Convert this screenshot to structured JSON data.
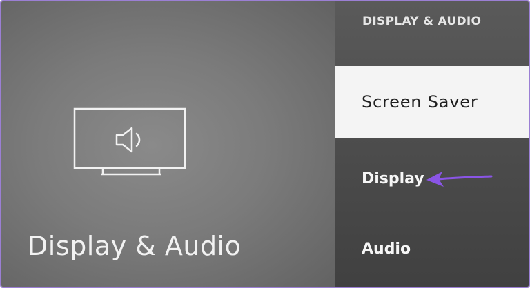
{
  "colors": {
    "accent_border": "#9b7fd4",
    "arrow": "#8a55e6",
    "selected_bg": "#f4f4f4",
    "left_pane_bg": "#7b7b7b",
    "right_pane_bg": "#4b4b4b"
  },
  "left_pane": {
    "icon": "tv-speaker-icon",
    "title": "Display & Audio"
  },
  "menu": {
    "header": "DISPLAY & AUDIO",
    "items": [
      {
        "label": "Screen Saver",
        "selected": true
      },
      {
        "label": "Display",
        "selected": false
      },
      {
        "label": "Audio",
        "selected": false
      }
    ]
  },
  "annotation": {
    "icon": "arrow-left-icon"
  }
}
